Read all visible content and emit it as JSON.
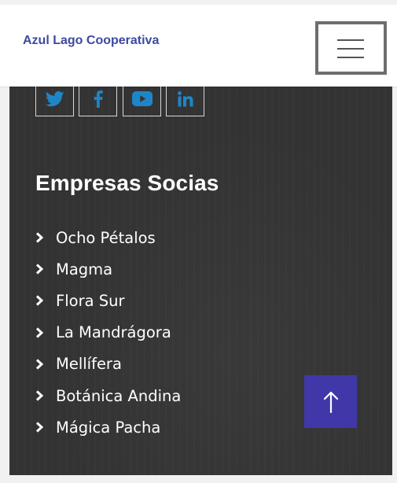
{
  "header": {
    "brand": "Azul Lago Cooperativa",
    "menu_icon": "hamburger-menu-icon"
  },
  "social_links": [
    {
      "name": "twitter",
      "icon": "twitter-icon"
    },
    {
      "name": "facebook",
      "icon": "facebook-icon"
    },
    {
      "name": "youtube",
      "icon": "youtube-icon"
    },
    {
      "name": "linkedin",
      "icon": "linkedin-icon"
    }
  ],
  "partners": {
    "title": "Empresas Socias",
    "items": [
      {
        "label": "Ocho Pétalos"
      },
      {
        "label": "Magma"
      },
      {
        "label": "Flora Sur"
      },
      {
        "label": "La Mandrágora"
      },
      {
        "label": "Mellífera"
      },
      {
        "label": "Botánica Andina"
      },
      {
        "label": "Mágica Pacha"
      }
    ]
  },
  "scroll_top": {
    "icon": "arrow-up-icon"
  },
  "colors": {
    "brand_text": "#3b4aa0",
    "footer_bg": "#333333",
    "social_icon": "#1e86c7",
    "scroll_top_bg": "#4038a8"
  }
}
